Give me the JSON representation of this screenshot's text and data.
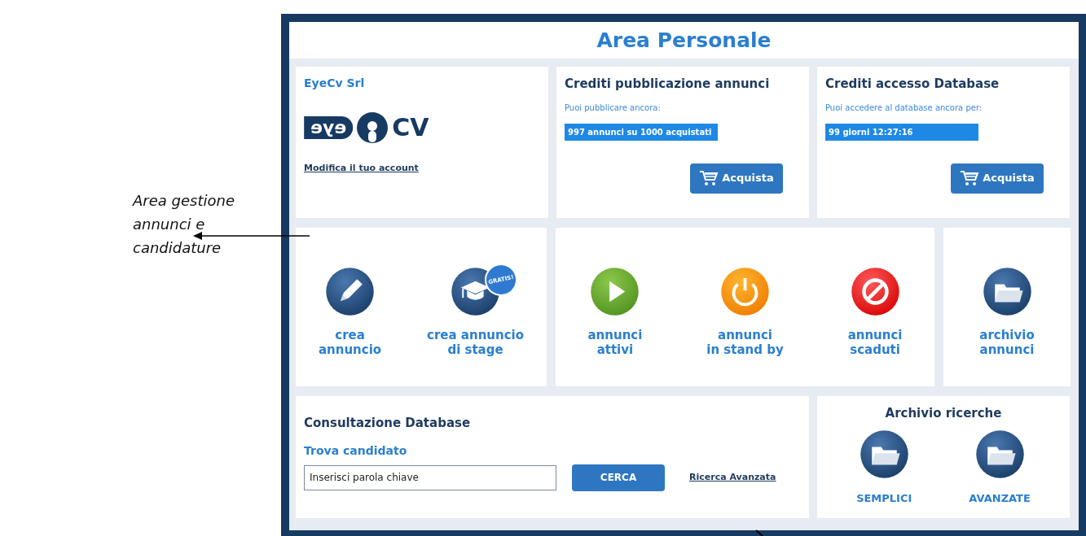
{
  "annotation": {
    "lines": [
      "Area gestione",
      "annunci e",
      "candidature"
    ]
  },
  "page_title": "Area Personale",
  "account": {
    "company": "EyeCv Srl",
    "logo": {
      "left": "eye",
      "right": "CV"
    },
    "link": "Modifica il tuo account"
  },
  "credit_cards": [
    {
      "title": "Crediti pubblicazione annunci",
      "subtitle": "Puoi pubblicare ancora:",
      "value": "997 annunci su 1000 acquistati",
      "button": "Acquista"
    },
    {
      "title": "Crediti accesso Database",
      "subtitle": "Puoi accedere al database ancora per:",
      "value": "99 giorni 12:27:16",
      "button": "Acquista"
    }
  ],
  "action_groups": [
    {
      "items": [
        {
          "kind": "pen",
          "label": "crea\nannuncio"
        },
        {
          "kind": "cap",
          "label": "crea annuncio\ndi stage",
          "badge": "GRATIS!"
        }
      ]
    },
    {
      "items": [
        {
          "kind": "play",
          "label": "annunci\nattivi"
        },
        {
          "kind": "power",
          "label": "annunci\nin stand by"
        },
        {
          "kind": "stop",
          "label": "annunci\nscaduti"
        }
      ]
    },
    {
      "items": [
        {
          "kind": "folder",
          "label": "archivio\nannunci"
        }
      ]
    }
  ],
  "database": {
    "title": "Consultazione Database",
    "subtitle": "Trova candidato",
    "search_placeholder": "Inserisci parola chiave",
    "button": "CERCA",
    "link": "Ricerca Avanzata"
  },
  "searches_archive": {
    "title": "Archivio ricerche",
    "items": [
      {
        "label": "SEMPLICI"
      },
      {
        "label": "AVANZATE"
      }
    ]
  }
}
